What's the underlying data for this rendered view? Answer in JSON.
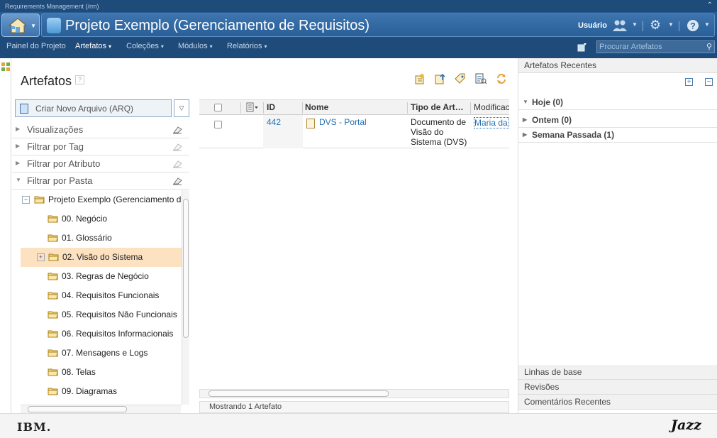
{
  "header": {
    "app_strip": "Requirements Management (/rm)",
    "project_title": "Projeto Exemplo (Gerenciamento de Requisitos)",
    "user_label": "Usuário"
  },
  "nav": {
    "items": [
      "Painel do Projeto",
      "Artefatos",
      "Coleções",
      "Módulos",
      "Relatórios"
    ],
    "search_placeholder": "Procurar Artefatos"
  },
  "page": {
    "title": "Artefatos",
    "help": "?"
  },
  "left_panel": {
    "new_artifact_label": "Criar Novo Arquivo (ARQ)",
    "filters": [
      "Visualizações",
      "Filtrar por Tag",
      "Filtrar por Atributo",
      "Filtrar por Pasta"
    ],
    "tree_root": "Projeto Exemplo (Gerenciamento d",
    "folders": [
      "00. Negócio",
      "01. Glossário",
      "02. Visão do Sistema",
      "03. Regras de Negócio",
      "04. Requisitos Funcionais",
      "05. Requisitos Não Funcionais",
      "06. Requisitos Informacionais",
      "07. Mensagens e Logs",
      "08. Telas",
      "09. Diagramas"
    ],
    "selected_folder": "02. Visão do Sistema"
  },
  "table": {
    "columns": [
      "ID",
      "Nome",
      "Tipo de Art…",
      "Modificac"
    ],
    "rows": [
      {
        "id": "442",
        "name": "DVS - Portal",
        "type_line1": "Documento de",
        "type_line2": "Visão do",
        "type_line3": "Sistema (DVS)",
        "modified_by": "Maria da"
      }
    ],
    "status": "Mostrando 1 Artefato"
  },
  "right_panel": {
    "title": "Artefatos Recentes",
    "groups": [
      "Hoje (0)",
      "Ontem (0)",
      "Semana Passada (1)"
    ],
    "bottom_sections": [
      "Linhas de base",
      "Revisões",
      "Comentários Recentes"
    ]
  },
  "footer": {
    "left_logo": "IBM.",
    "right_logo": "Jazz"
  },
  "colors": {
    "banner": "#1f4b7a",
    "link": "#2470b3",
    "selected_row": "#fde2c2"
  }
}
